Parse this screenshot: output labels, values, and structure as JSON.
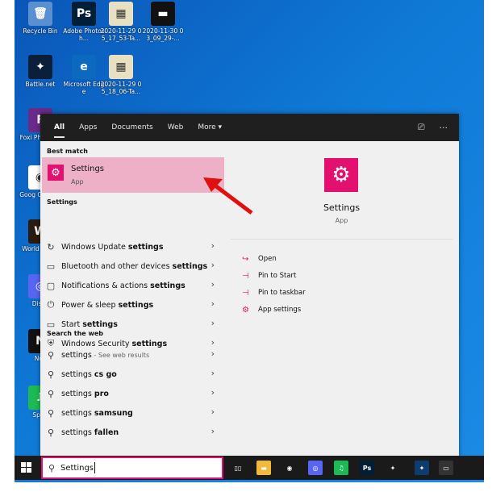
{
  "desktop": {
    "icons": [
      {
        "label": "Recycle Bin",
        "glyph": "🗑"
      },
      {
        "label": "Adobe Photosh...",
        "glyph": "Ps"
      },
      {
        "label": "2020-11-29 05_17_53-Ta...",
        "glyph": "▦"
      },
      {
        "label": "2020-11-30 03_09_29-...",
        "glyph": "▬"
      },
      {
        "label": "Battle.net",
        "glyph": "✦"
      },
      {
        "label": "Microsoft Edge",
        "glyph": "e"
      },
      {
        "label": "2020-11-29 05_18_06-Ta...",
        "glyph": "▦"
      },
      {
        "label": "Foxi Phantom",
        "glyph": "F"
      },
      {
        "label": "Goog Chrome",
        "glyph": "◉"
      },
      {
        "label": "World Warcr",
        "glyph": "W"
      },
      {
        "label": "Disco",
        "glyph": "◎"
      },
      {
        "label": "Nox",
        "glyph": "N"
      },
      {
        "label": "Spoti",
        "glyph": "♫"
      }
    ]
  },
  "topbar": {
    "tabs": [
      "All",
      "Apps",
      "Documents",
      "Web",
      "More ▾"
    ],
    "feedback_icon": "feedback-icon",
    "more_icon": "ellipsis-icon"
  },
  "left": {
    "best_match_header": "Best match",
    "best_match": {
      "title": "Settings",
      "subtitle": "App"
    },
    "settings_header": "Settings",
    "settings_items": [
      {
        "icon": "↻",
        "prefix": "Windows Update ",
        "bold": "settings"
      },
      {
        "icon": "▭",
        "prefix": "Bluetooth and other devices ",
        "bold": "settings"
      },
      {
        "icon": "▢",
        "prefix": "Notifications & actions ",
        "bold": "settings"
      },
      {
        "icon": "⏻",
        "prefix": "Power & sleep ",
        "bold": "settings"
      },
      {
        "icon": "▭",
        "prefix": "Start ",
        "bold": "settings"
      },
      {
        "icon": "⛨",
        "prefix": "Windows Security ",
        "bold": "settings"
      }
    ],
    "web_header": "Search the web",
    "web_items": [
      {
        "prefix": "settings",
        "bold": "",
        "sub": " - See web results"
      },
      {
        "prefix": "settings ",
        "bold": "cs go",
        "sub": ""
      },
      {
        "prefix": "settings ",
        "bold": "pro",
        "sub": ""
      },
      {
        "prefix": "settings ",
        "bold": "samsung",
        "sub": ""
      },
      {
        "prefix": "settings ",
        "bold": "fallen",
        "sub": ""
      }
    ]
  },
  "right": {
    "app_name": "Settings",
    "app_type": "App",
    "actions": [
      {
        "icon": "↪",
        "label": "Open"
      },
      {
        "icon": "⊣",
        "label": "Pin to Start"
      },
      {
        "icon": "⊣",
        "label": "Pin to taskbar"
      },
      {
        "icon": "⚙",
        "label": "App settings"
      }
    ]
  },
  "taskbar": {
    "search_value": "Settings",
    "apps": [
      {
        "name": "task-view",
        "glyph": "▯▯",
        "color": "#1a1a1a"
      },
      {
        "name": "file-explorer",
        "glyph": "▬",
        "color": "#f2b93b"
      },
      {
        "name": "chrome",
        "glyph": "◉",
        "color": "#1a1a1a"
      },
      {
        "name": "discord",
        "glyph": "◎",
        "color": "#5865f2"
      },
      {
        "name": "spotify",
        "glyph": "♫",
        "color": "#1db954"
      },
      {
        "name": "photoshop",
        "glyph": "Ps",
        "color": "#001e36"
      },
      {
        "name": "battle-net",
        "glyph": "✦",
        "color": "#1a1a1a"
      },
      {
        "name": "battle-net-2",
        "glyph": "✦",
        "color": "#0e3c6e"
      },
      {
        "name": "terminal",
        "glyph": "▭",
        "color": "#333"
      }
    ]
  },
  "colors": {
    "accent": "#e3106f",
    "highlight": "#eeb0c6",
    "arrow": "#e01010"
  }
}
